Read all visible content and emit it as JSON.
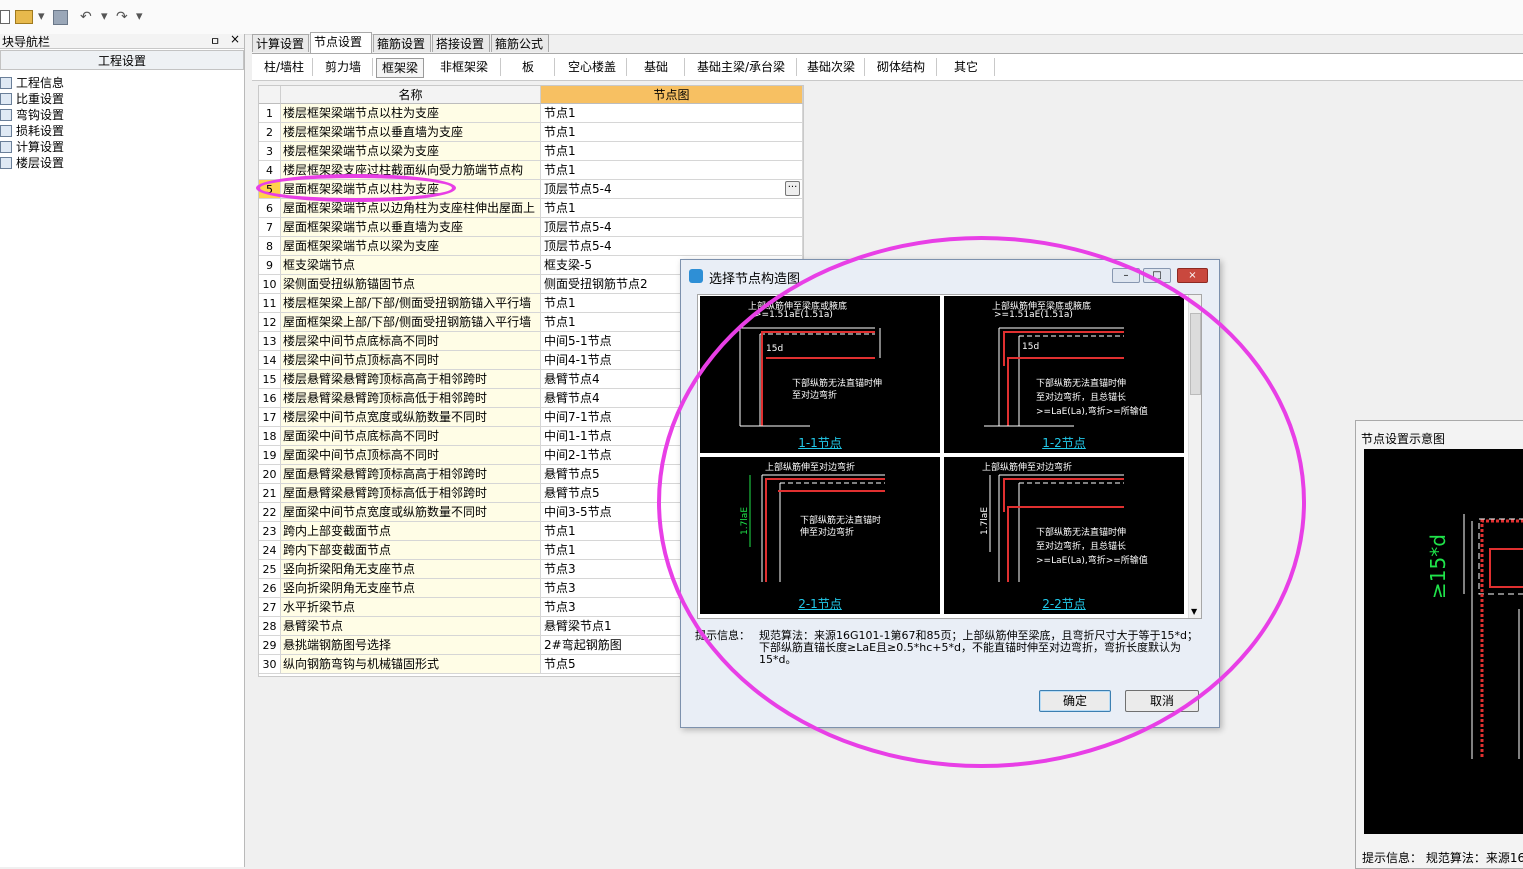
{
  "toolbar": {
    "icons": [
      "new-file-icon",
      "open-folder-icon",
      "save-icon",
      "undo-icon",
      "redo-icon"
    ]
  },
  "nav": {
    "title": "块导航栏",
    "pin": "ㅁ",
    "close": "×",
    "section": "工程设置",
    "items": [
      {
        "label": "工程信息"
      },
      {
        "label": "比重设置"
      },
      {
        "label": "弯钩设置"
      },
      {
        "label": "损耗设置"
      },
      {
        "label": "计算设置"
      },
      {
        "label": "楼层设置"
      }
    ]
  },
  "tabs": [
    {
      "label": "计算设置"
    },
    {
      "label": "节点设置",
      "active": true
    },
    {
      "label": "箍筋设置"
    },
    {
      "label": "搭接设置"
    },
    {
      "label": "箍筋公式"
    }
  ],
  "subtabs": [
    {
      "label": "柱/墙柱"
    },
    {
      "label": "剪力墙"
    },
    {
      "label": "框架梁",
      "active": true
    },
    {
      "label": "非框架梁"
    },
    {
      "label": "板"
    },
    {
      "label": "空心楼盖"
    },
    {
      "label": "基础"
    },
    {
      "label": "基础主梁/承台梁"
    },
    {
      "label": "基础次梁"
    },
    {
      "label": "砌体结构"
    },
    {
      "label": "其它"
    }
  ],
  "grid": {
    "col_name": "名称",
    "col_value": "节点图",
    "ellipsis": "···",
    "rows": [
      {
        "n": "1",
        "name": "楼层框架梁端节点以柱为支座",
        "value": "节点1"
      },
      {
        "n": "2",
        "name": "楼层框架梁端节点以垂直墙为支座",
        "value": "节点1"
      },
      {
        "n": "3",
        "name": "楼层框架梁端节点以梁为支座",
        "value": "节点1"
      },
      {
        "n": "4",
        "name": "楼层框架梁支座过柱截面纵向受力筋端节点构",
        "value": "节点1"
      },
      {
        "n": "5",
        "name": "屋面框架梁端节点以柱为支座",
        "value": "顶层节点5-4"
      },
      {
        "n": "6",
        "name": "屋面框架梁端节点以边角柱为支座柱伸出屋面上",
        "value": "节点1"
      },
      {
        "n": "7",
        "name": "屋面框架梁端节点以垂直墙为支座",
        "value": "顶层节点5-4"
      },
      {
        "n": "8",
        "name": "屋面框架梁端节点以梁为支座",
        "value": "顶层节点5-4"
      },
      {
        "n": "9",
        "name": "框支梁端节点",
        "value": "框支梁-5"
      },
      {
        "n": "10",
        "name": "梁侧面受扭纵筋锚固节点",
        "value": "侧面受扭钢筋节点2"
      },
      {
        "n": "11",
        "name": "楼层框架梁上部/下部/侧面受扭钢筋锚入平行墙",
        "value": "节点1"
      },
      {
        "n": "12",
        "name": "屋面框架梁上部/下部/侧面受扭钢筋锚入平行墙",
        "value": "节点1"
      },
      {
        "n": "13",
        "name": "楼层梁中间节点底标高不同时",
        "value": "中间5-1节点"
      },
      {
        "n": "14",
        "name": "楼层梁中间节点顶标高不同时",
        "value": "中间4-1节点"
      },
      {
        "n": "15",
        "name": "楼层悬臂梁悬臂跨顶标高高于相邻跨时",
        "value": "悬臂节点4"
      },
      {
        "n": "16",
        "name": "楼层悬臂梁悬臂跨顶标高低于相邻跨时",
        "value": "悬臂节点4"
      },
      {
        "n": "17",
        "name": "楼层梁中间节点宽度或纵筋数量不同时",
        "value": "中间7-1节点"
      },
      {
        "n": "18",
        "name": "屋面梁中间节点底标高不同时",
        "value": "中间1-1节点"
      },
      {
        "n": "19",
        "name": "屋面梁中间节点顶标高不同时",
        "value": "中间2-1节点"
      },
      {
        "n": "20",
        "name": "屋面悬臂梁悬臂跨顶标高高于相邻跨时",
        "value": "悬臂节点5"
      },
      {
        "n": "21",
        "name": "屋面悬臂梁悬臂跨顶标高低于相邻跨时",
        "value": "悬臂节点5"
      },
      {
        "n": "22",
        "name": "屋面梁中间节点宽度或纵筋数量不同时",
        "value": "中间3-5节点"
      },
      {
        "n": "23",
        "name": "跨内上部变截面节点",
        "value": "节点1"
      },
      {
        "n": "24",
        "name": "跨内下部变截面节点",
        "value": "节点1"
      },
      {
        "n": "25",
        "name": "竖向折梁阳角无支座节点",
        "value": "节点3"
      },
      {
        "n": "26",
        "name": "竖向折梁阴角无支座节点",
        "value": "节点3"
      },
      {
        "n": "27",
        "name": "水平折梁节点",
        "value": "节点3"
      },
      {
        "n": "28",
        "name": "悬臂梁节点",
        "value": "悬臂梁节点1"
      },
      {
        "n": "29",
        "name": "悬挑端钢筋图号选择",
        "value": "2#弯起钢筋图"
      },
      {
        "n": "30",
        "name": "纵向钢筋弯钩与机械锚固形式",
        "value": "节点5"
      }
    ]
  },
  "dialog": {
    "title": "选择节点构造图",
    "min": "–",
    "max": "□",
    "close": "×",
    "thumbs": [
      {
        "caption": "1-1节点",
        "top": "上部纵筋伸至梁底或腋底",
        "top2": ">=1.51aE(1.51a)",
        "mid": "15d",
        "bot1": "下部纵筋无法直锚时伸",
        "bot2": "至对边弯折"
      },
      {
        "caption": "1-2节点",
        "top": "上部纵筋伸至梁底或腋底",
        "top2": ">=1.51aE(1.51a)",
        "mid": "15d",
        "bot1": "下部纵筋无法直锚时伸",
        "bot2": "至对边弯折，且总锚长",
        "bot3": ">=LaE(La),弯折>=所输值"
      },
      {
        "caption": "2-1节点",
        "top": "上部纵筋伸至对边弯折",
        "top2": "",
        "mid": "1.7laE",
        "bot1": "下部纵筋无法直锚时",
        "bot2": "伸至对边弯折"
      },
      {
        "caption": "2-2节点",
        "top": "上部纵筋伸至对边弯折",
        "top2": "",
        "mid": "1.7laE",
        "bot1": "下部纵筋无法直锚时伸",
        "bot2": "至对边弯折，且总锚长",
        "bot3": ">=LaE(La),弯折>=所输值"
      }
    ],
    "hint_label": "提示信息：",
    "hint_text": "规范算法：来源16G101-1第67和85页；上部纵筋伸至梁底，且弯折尺寸大于等于15*d；下部纵筋直锚长度≥LaE且≥0.5*hc+5*d，不能直锚时伸至对边弯折，弯折长度默认为15*d。",
    "ok": "确定",
    "cancel": "取消"
  },
  "right_panel": {
    "title": "节点设置示意图",
    "dim_label": "≥15*d",
    "hint": "提示信息：  规范算法：来源16"
  },
  "colors": {
    "annotation": "#e83fe6",
    "header_value": "#f7c062",
    "name_col": "#fffde6",
    "selected_row": "#ffd24a"
  }
}
